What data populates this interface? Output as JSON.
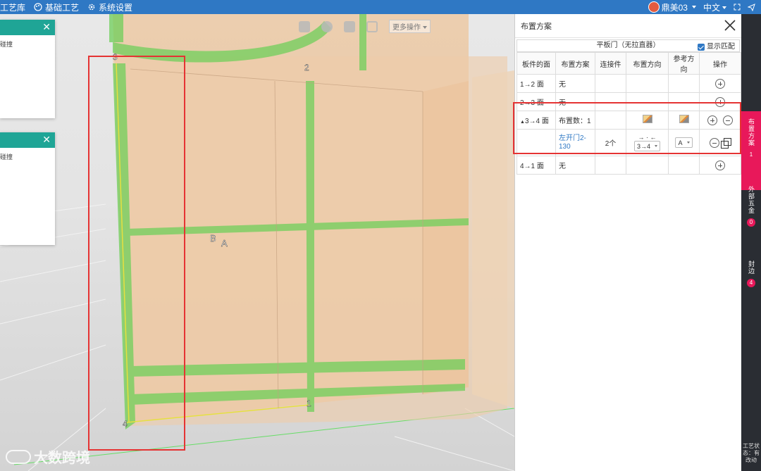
{
  "topbar": {
    "nav": [
      {
        "label": "工艺库",
        "icon": "library-icon"
      },
      {
        "label": "基础工艺",
        "icon": "palette-icon"
      },
      {
        "label": "系统设置",
        "icon": "gear-icon"
      }
    ],
    "user": "鼎美03",
    "language": "中文"
  },
  "viewport": {
    "float_windows": [
      {
        "body": "碰撞"
      },
      {
        "body": "碰撞"
      }
    ],
    "toolbar": {
      "more_label": "更多操作"
    },
    "labels": {
      "p1": "1",
      "p2": "2",
      "p3": "3",
      "p4": "4",
      "a": "A",
      "b": "B"
    },
    "watermark": "大数跨境"
  },
  "panel": {
    "title": "布置方案",
    "subheader": "平板门（无拉直器）",
    "show_match_label": "显示匹配",
    "columns": [
      "板件的面",
      "布置方案",
      "连接件",
      "布置方向",
      "参考方向",
      "操作"
    ],
    "rows": {
      "r1": {
        "face": "1→2 面",
        "scheme": "无"
      },
      "r2": {
        "face": "2→3 面",
        "scheme": "无"
      },
      "r3": {
        "face": "3→4 面",
        "scheme": "布置数：1"
      },
      "r3_detail": {
        "scheme_link": "左开门2-130",
        "connector": "2个",
        "direction_symbol": "→ · ←",
        "direction_select": "3→4",
        "reference_select": "A"
      },
      "r4": {
        "face": "4→1 面",
        "scheme": "无"
      }
    }
  },
  "rail": {
    "tabs": [
      {
        "label": "布置方案",
        "count": "1"
      },
      {
        "label": "外部五金",
        "count": "0"
      },
      {
        "label": "封边",
        "count": "4"
      }
    ],
    "status": "工艺状态：有改动"
  }
}
